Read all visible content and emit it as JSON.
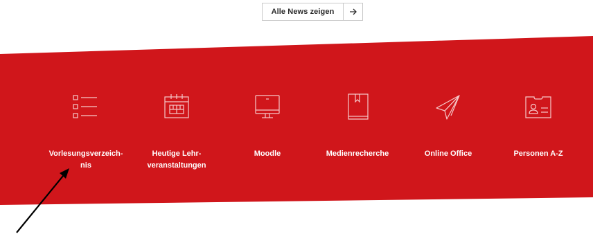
{
  "news_button": {
    "label": "Alle News zeigen",
    "icon": "arrow-right-icon"
  },
  "band_color": "#d0161b",
  "quicklinks": [
    {
      "label": "Vorlesungsverzeich-\nnis",
      "icon": "list-icon"
    },
    {
      "label": "Heutige Lehr-\nveranstaltungen",
      "icon": "calendar-icon"
    },
    {
      "label": "Moodle",
      "icon": "monitor-icon"
    },
    {
      "label": "Medienrecherche",
      "icon": "book-icon"
    },
    {
      "label": "Online Office",
      "icon": "paper-plane-icon"
    },
    {
      "label": "Personen A-Z",
      "icon": "id-card-icon"
    }
  ]
}
